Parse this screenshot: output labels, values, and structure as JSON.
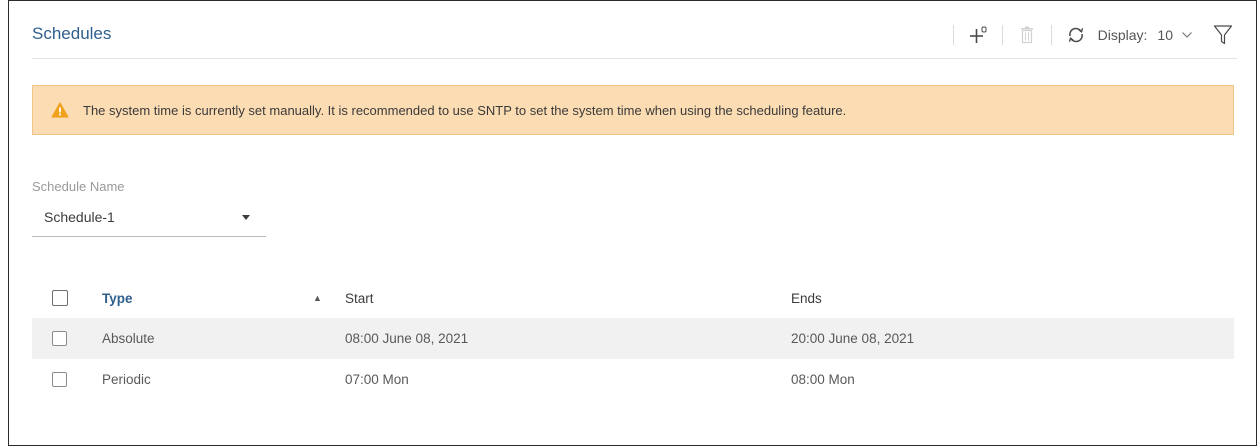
{
  "page": {
    "title": "Schedules"
  },
  "toolbar": {
    "add_icon": "add-icon",
    "delete_icon": "trash-icon",
    "refresh_icon": "refresh-icon",
    "display_label": "Display:",
    "display_value": "10",
    "filter_icon": "filter-icon"
  },
  "alert": {
    "icon": "warning-icon",
    "text": "The system time is currently set manually. It is recommended to use SNTP to set the system time when using the scheduling feature."
  },
  "schedule_name": {
    "label": "Schedule Name",
    "value": "Schedule-1"
  },
  "table": {
    "headers": {
      "type": "Type",
      "sort_indicator": "▲",
      "start": "Start",
      "ends": "Ends"
    },
    "rows": [
      {
        "type": "Absolute",
        "start": "08:00 June 08, 2021",
        "ends": "20:00 June 08, 2021"
      },
      {
        "type": "Periodic",
        "start": "07:00 Mon",
        "ends": "08:00 Mon"
      }
    ]
  },
  "colors": {
    "accent": "#2f5f8c",
    "alert_bg": "#fcdcb3",
    "alert_border": "#f3c488",
    "warning_icon": "#f0a21e",
    "row_alt": "#f1f1f1"
  }
}
